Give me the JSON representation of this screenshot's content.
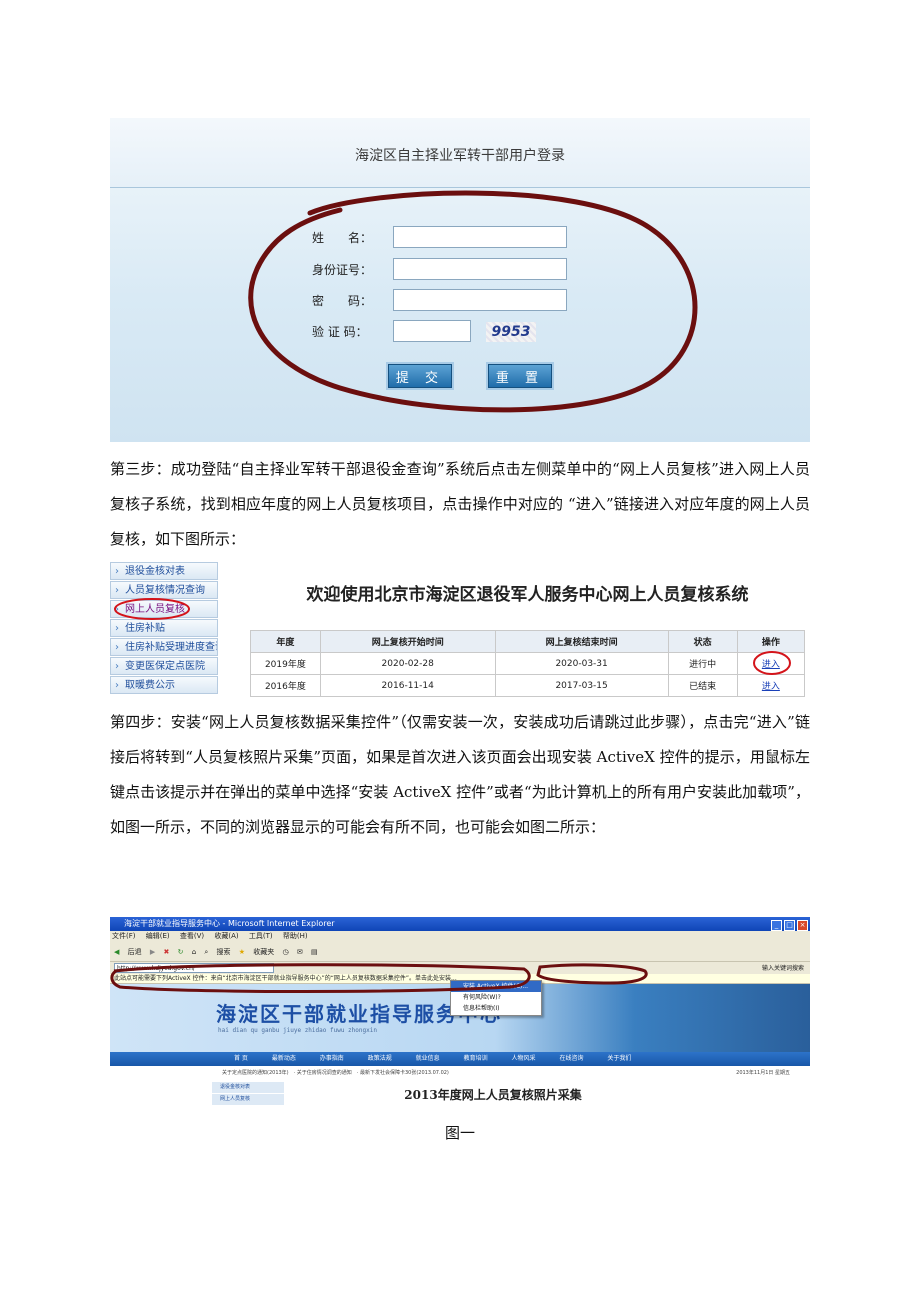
{
  "login": {
    "title": "海淀区自主择业军转干部用户登录",
    "fields": [
      {
        "label": "姓　　名："
      },
      {
        "label": "身份证号："
      },
      {
        "label": "密　　码："
      },
      {
        "label": "验 证 码："
      }
    ],
    "captcha": "9953",
    "submit_label": "提 交",
    "reset_label": "重 置"
  },
  "step3": "第三步：成功登陆“自主择业军转干部退役金查询”系统后点击左侧菜单中的“网上人员复核”进入网上人员复核子系统，找到相应年度的网上人员复核项目，点击操作中对应的 “进入”链接进入对应年度的网上人员复核，如下图所示：",
  "review": {
    "menu": [
      "退役金核对表",
      "人员复核情况查询",
      "网上人员复核",
      "住房补贴",
      "住房补贴受理进度查询",
      "变更医保定点医院",
      "取暖费公示"
    ],
    "welcome": "欢迎使用北京市海淀区退役军人服务中心网上人员复核系统",
    "headers": [
      "年度",
      "网上复核开始时间",
      "网上复核结束时间",
      "状态",
      "操作"
    ],
    "rows": [
      {
        "year": "2019年度",
        "start": "2020-02-28",
        "end": "2020-03-31",
        "status": "进行中",
        "action": "进入"
      },
      {
        "year": "2016年度",
        "start": "2016-11-14",
        "end": "2017-03-15",
        "status": "已结束",
        "action": "进入"
      }
    ]
  },
  "step4": "第四步：安装“网上人员复核数据采集控件”（仅需安装一次，安装成功后请跳过此步骤），点击完“进入”链接后将转到“人员复核照片采集”页面，如果是首次进入该页面会出现安装 ActiveX 控件的提示，用鼠标左键点击该提示并在弹出的菜单中选择“安装 ActiveX 控件”或者“为此计算机上的所有用户安装此加载项”，如图一所示，不同的浏览器显示的可能会有所不同，也可能会如图二所示：",
  "ie": {
    "window_title": "海淀干部就业指导服务中心 - Microsoft Internet Explorer",
    "menus": [
      "文件(F)",
      "编辑(E)",
      "查看(V)",
      "收藏(A)",
      "工具(T)",
      "帮助(H)"
    ],
    "toolbar": [
      "后退",
      "搜索",
      "收藏夹"
    ],
    "address": "http://www.hdjycd.gov.cn/",
    "search_hint": "输入关键词搜索",
    "infobar": "此站点可能需要下列ActiveX 控件：来自“北京市海淀区干部就业指导服务中心”的“网上人员复核数据采集控件”。单击此处安装...",
    "context_menu": [
      "安装 ActiveX 控件(C)...",
      "有何风险(W)?",
      "信息栏帮助(I)"
    ],
    "site_title": "海淀区干部就业指导服务中心",
    "site_subtitle": "hai dian qu ganbu jiuye zhidao fuwu zhongxin",
    "nav": [
      "首 页",
      "最新动态",
      "办事指南",
      "政策法规",
      "就业信息",
      "教育培训",
      "人物风采",
      "在线咨询",
      "关于我们"
    ],
    "news": "关于定点医院的通知(2013年)　· 关于住房情况调查的通知　· 最新下发社会保障卡30张(2013.07.02)",
    "news_date": "2013年11月1日 星期五",
    "left_menu": [
      "退役金核对表",
      "网上人员复核"
    ],
    "page_title": "2013年度网上人员复核照片采集"
  },
  "caption": "图一"
}
